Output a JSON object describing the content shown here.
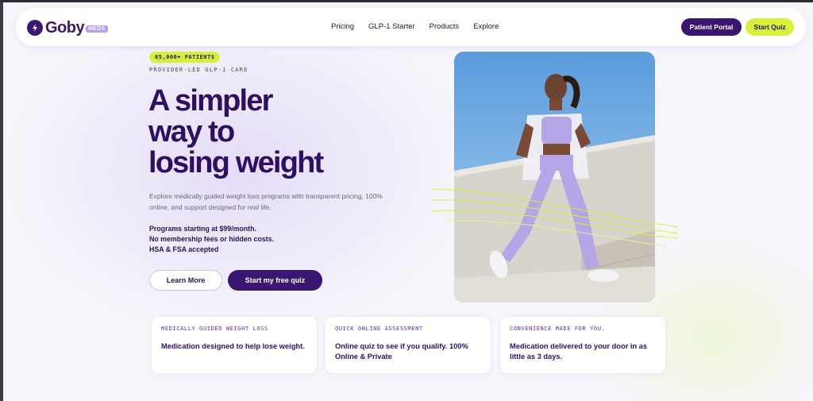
{
  "brand": {
    "name": "Goby",
    "badge": "MEDS",
    "logo_icon": "bolt-icon"
  },
  "nav": {
    "links": [
      "Pricing",
      "GLP-1 Starter",
      "Products",
      "Explore"
    ],
    "portal_label": "Patient Portal",
    "quiz_label": "Start Quiz"
  },
  "hero": {
    "pill": "65,000+ PATIENTS",
    "eyebrow": "PROVIDER-LED GLP-1 CARE",
    "headline": [
      "A simpler",
      "way to",
      "losing weight"
    ],
    "subtext": "Explore medically guided weight loss programs with transparent pricing, 100% online, and support designed for real life.",
    "pricing_lines": [
      "Programs starting at $99/month.",
      "No membership fees or hidden costs.",
      "HSA & FSA accepted"
    ],
    "learn_more_label": "Learn More",
    "start_quiz_label": "Start my free quiz"
  },
  "cards": [
    {
      "eyebrow": "MEDICALLY GUIDED WEIGHT LOSS",
      "text": "Medication designed to help lose weight."
    },
    {
      "eyebrow": "QUICK ONLINE ASSESSMENT",
      "text": "Online quiz to see if you qualify. 100% Online & Private"
    },
    {
      "eyebrow": "CONVENIENCE MADE FOR YOU.",
      "text": "Medication delivered to your door in as little as 3 days."
    }
  ],
  "colors": {
    "brand_purple": "#3b1670",
    "accent_lime": "#d9f03a",
    "heading": "#2f0f63",
    "background": "#f6f5fb"
  }
}
